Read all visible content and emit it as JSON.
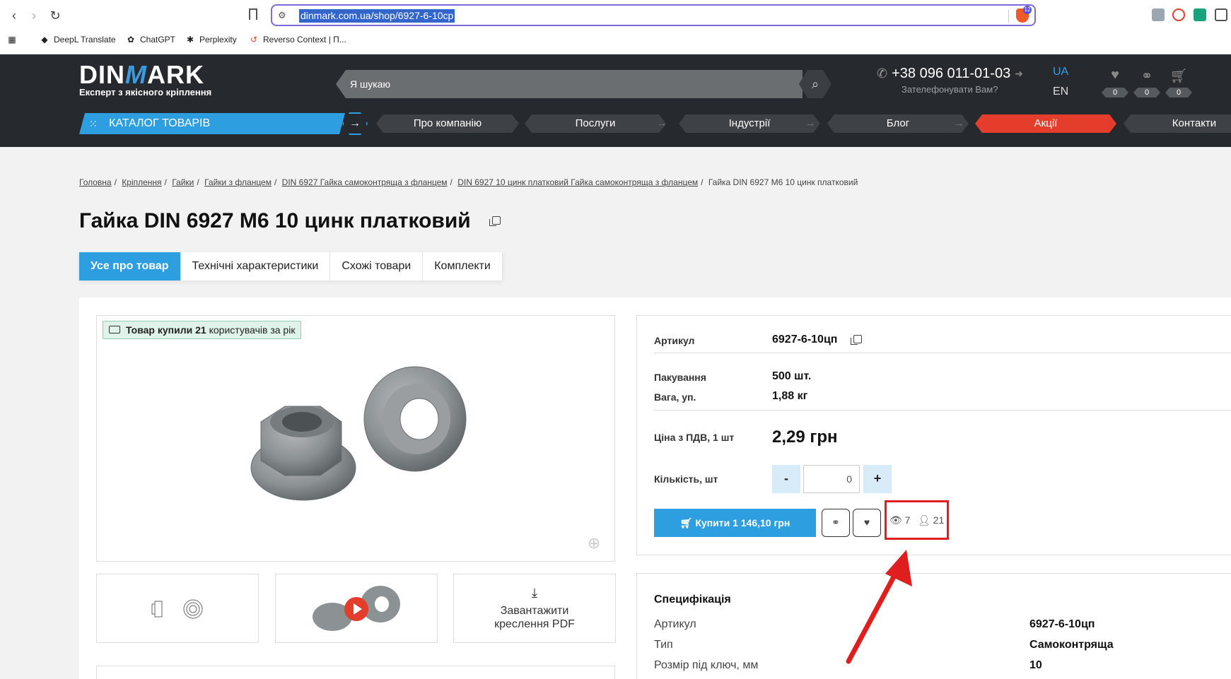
{
  "browser": {
    "url": "dinmark.com.ua/shop/6927-6-10cp",
    "brave_badge": "12",
    "bookmarks": [
      {
        "label": "DeepL Translate",
        "icon": "deepl-icon"
      },
      {
        "label": "ChatGPT",
        "icon": "chatgpt-icon"
      },
      {
        "label": "Perplexity",
        "icon": "perplexity-icon"
      },
      {
        "label": "Reverso Context | П...",
        "icon": "reverso-icon"
      }
    ]
  },
  "header": {
    "logo_left": "DIN",
    "logo_mid": "M",
    "logo_right": "ARK",
    "tagline": "Експерт з якісного кріплення",
    "search_placeholder": "Я шукаю",
    "phone": "+38 096 011-01-03",
    "callback": "Зателефонувати Вам?",
    "lang_active": "UA",
    "lang_other": "EN",
    "counters": {
      "favorites": "0",
      "compare": "0",
      "cart": "0"
    },
    "catalog_label": "КАТАЛОГ ТОВАРІВ",
    "nav": [
      "Про компанію",
      "Послуги",
      "Індустрії",
      "Блог",
      "Акції",
      "Контакти"
    ]
  },
  "breadcrumb": {
    "items": [
      "Головна",
      "Кріплення",
      "Гайки",
      "Гайки з фланцем",
      "DIN 6927 Гайка самоконтряща з фланцем",
      "DIN 6927 10 цинк платковий Гайка самоконтряща з фланцем"
    ],
    "current": "Гайка DIN 6927 M6 10 цинк платковий"
  },
  "product": {
    "title": "Гайка DIN 6927 M6 10 цинк платковий",
    "tabs": [
      "Усе про товар",
      "Технічні характеристики",
      "Схожі товари",
      "Комплекти"
    ],
    "bought_bold": "Товар купили 21",
    "bought_rest": " користувачів за рік",
    "pdf_label_1": "Завантажити",
    "pdf_label_2": "креслення PDF",
    "sku_label": "Артикул",
    "sku": "6927-6-10цп",
    "pack_label": "Пакування",
    "pack": "500 шт.",
    "weight_label": "Вага, уп.",
    "weight": "1,88 кг",
    "price_label": "Ціна з ПДВ, 1 шт",
    "price": "2,29 грн",
    "qty_label": "Кількість, шт",
    "qty_minus": "-",
    "qty_value": "0",
    "qty_plus": "+",
    "buy_label": "Купити 1 146,10 грн",
    "views": "7",
    "buyers": "21"
  },
  "spec": {
    "title": "Специфікація",
    "rows": [
      {
        "k": "Артикул",
        "v": "6927-6-10цп"
      },
      {
        "k": "Тип",
        "v": "Самоконтряща"
      },
      {
        "k": "Розмір під ключ, мм",
        "v": "10"
      }
    ]
  },
  "colors": {
    "accent": "#2d9ee0",
    "sale": "#e53d2b",
    "header_bg": "#262a2e",
    "highlight": "#e01e1e"
  }
}
